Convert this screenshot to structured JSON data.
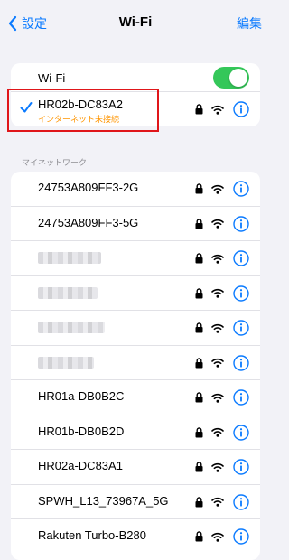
{
  "nav": {
    "back_label": "設定",
    "title": "Wi-Fi",
    "edit_label": "編集"
  },
  "wifi": {
    "label": "Wi-Fi",
    "enabled": true
  },
  "connected": {
    "name": "HR02b-DC83A2",
    "status": "インターネット未接続"
  },
  "section_header": "マイネットワーク",
  "networks": [
    {
      "name": "24753A809FF3-2G",
      "blurred": false
    },
    {
      "name": "24753A809FF3-5G",
      "blurred": false
    },
    {
      "name": "",
      "blurred": true
    },
    {
      "name": "",
      "blurred": true
    },
    {
      "name": "",
      "blurred": true
    },
    {
      "name": "",
      "blurred": true
    },
    {
      "name": "HR01a-DB0B2C",
      "blurred": false
    },
    {
      "name": "HR01b-DB0B2D",
      "blurred": false
    },
    {
      "name": "HR02a-DC83A1",
      "blurred": false
    },
    {
      "name": "SPWH_L13_73967A_5G",
      "blurred": false
    },
    {
      "name": "Rakuten Turbo-B280",
      "blurred": false
    }
  ],
  "colors": {
    "accent": "#0a7aff",
    "toggle_on": "#34c759",
    "status_warning": "#ff9500",
    "highlight": "#e0161a"
  },
  "icons": {
    "back": "chevron-left-icon",
    "check": "checkmark-icon",
    "lock": "lock-icon",
    "wifi": "wifi-icon",
    "info": "info-icon"
  }
}
